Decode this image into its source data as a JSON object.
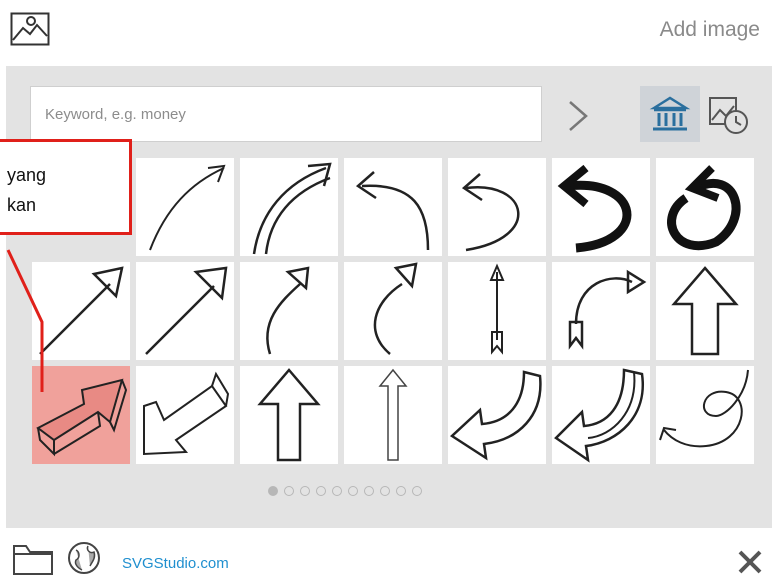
{
  "header": {
    "title": "Add image",
    "image_icon": "image-icon"
  },
  "search": {
    "placeholder": "Keyword, e.g. money",
    "next_icon": "chevron-right-icon",
    "library_icon": "library-icon",
    "history_icon": "history-icon"
  },
  "grid": {
    "rows": 3,
    "columns": 7,
    "selected_index": 14,
    "items": [
      "thin-curved-arrow",
      "double-curved-arrow",
      "curved-return-arrow",
      "u-turn-arrow",
      "bold-u-turn-arrow",
      "bold-loop-arrow",
      "diagonal-arrow",
      "diagonal-arrow-2",
      "curved-up-arrow",
      "curved-up-arrow-2",
      "feathered-arrow",
      "curved-feathered-arrow",
      "outline-up-arrow",
      "3d-arrow-right",
      "3d-arrow-left",
      "outline-up-arrow-2",
      "thin-outline-up-arrow",
      "curved-back-arrow",
      "curved-back-arrow-3d",
      "loop-back-arrow"
    ]
  },
  "pagination": {
    "total": 10,
    "current": 1
  },
  "footer": {
    "site": "SVGStudio.com",
    "folder_icon": "folder-icon",
    "globe_icon": "globe-icon",
    "close_icon": "close-icon"
  },
  "annotation": {
    "text": "yang\nkan",
    "color": "#e0201a"
  }
}
